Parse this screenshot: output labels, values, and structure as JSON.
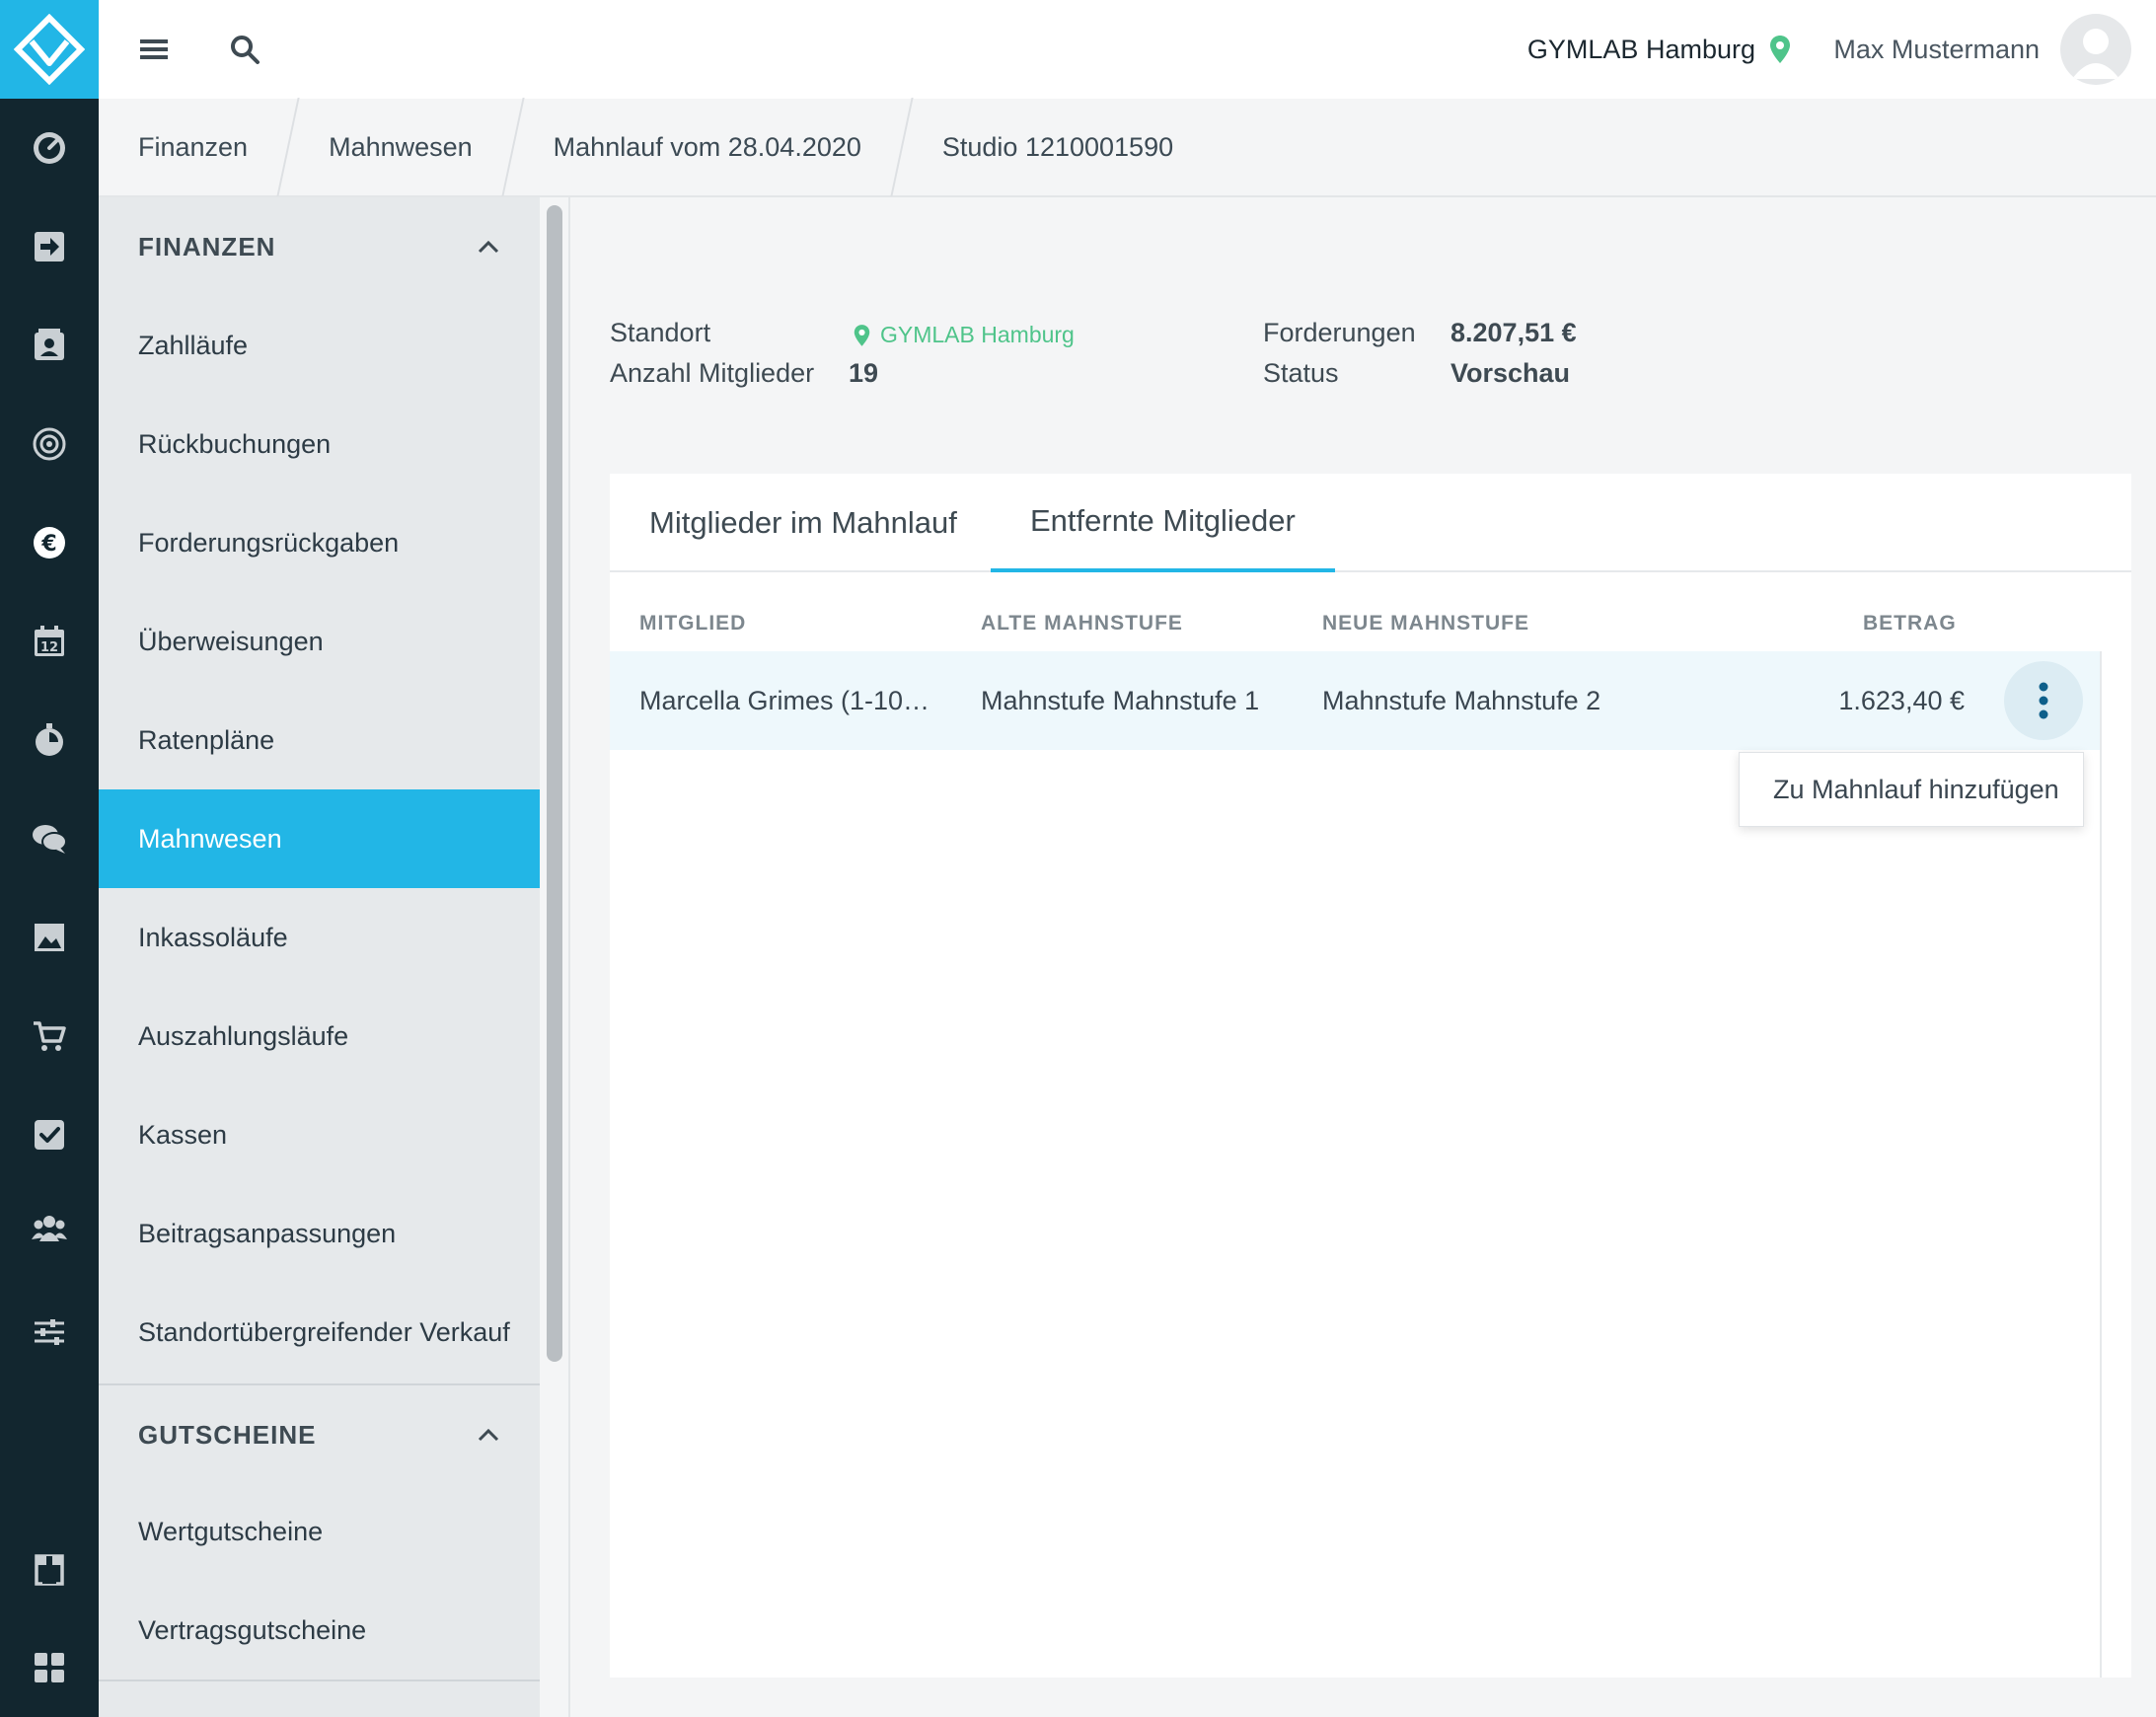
{
  "app": {
    "brand_color": "#22b6e6",
    "rail_color": "#12262f"
  },
  "rail": {
    "items": [
      {
        "icon": "dashboard-icon"
      },
      {
        "icon": "sign-in-icon"
      },
      {
        "icon": "member-card-icon"
      },
      {
        "icon": "target-icon"
      },
      {
        "icon": "euro-icon",
        "active": true
      },
      {
        "icon": "calendar-icon",
        "text": "12"
      },
      {
        "icon": "stopwatch-icon"
      },
      {
        "icon": "chat-icon"
      },
      {
        "icon": "image-icon"
      },
      {
        "icon": "cart-icon"
      },
      {
        "icon": "checkbox-icon"
      },
      {
        "icon": "users-icon"
      },
      {
        "icon": "sliders-icon"
      },
      {
        "icon": "store-icon"
      },
      {
        "icon": "apps-icon"
      }
    ]
  },
  "topbar": {
    "location": "GYMLAB Hamburg",
    "user": "Max Mustermann"
  },
  "breadcrumb": [
    "Finanzen",
    "Mahnwesen",
    "Mahnlauf vom 28.04.2020",
    "Studio 1210001590"
  ],
  "subnav": {
    "section1": "FINANZEN",
    "items1": [
      "Zahlläufe",
      "Rückbuchungen",
      "Forderungsrückgaben",
      "Überweisungen",
      "Ratenpläne",
      "Mahnwesen",
      "Inkassoläufe",
      "Auszahlungsläufe",
      "Kassen",
      "Beitragsanpassungen",
      "Standortübergreifender Verkauf"
    ],
    "active": "Mahnwesen",
    "section2": "GUTSCHEINE",
    "items2": [
      "Wertgutscheine",
      "Vertragsgutscheine"
    ]
  },
  "info": {
    "standort_label": "Standort",
    "standort_value": "GYMLAB Hamburg",
    "mitglieder_label": "Anzahl Mitglieder",
    "mitglieder_value": "19",
    "forderungen_label": "Forderungen",
    "forderungen_value": "8.207,51 €",
    "status_label": "Status",
    "status_value": "Vorschau"
  },
  "tabs": [
    "Mitglieder im Mahnlauf",
    "Entfernte Mitglieder"
  ],
  "active_tab": 1,
  "table": {
    "headers": [
      "MITGLIED",
      "ALTE MAHNSTUFE",
      "NEUE MAHNSTUFE",
      "BETRAG"
    ],
    "rows": [
      {
        "mitglied": "Marcella Grimes (1-10…",
        "alt": "Mahnstufe Mahnstufe 1",
        "neu": "Mahnstufe Mahnstufe 2",
        "betrag": "1.623,40 €"
      }
    ]
  },
  "row_menu": {
    "item": "Zu Mahnlauf hinzufügen"
  },
  "colors": {
    "location_green": "#4fc48a",
    "kebab_blue": "#0e5f8a"
  }
}
